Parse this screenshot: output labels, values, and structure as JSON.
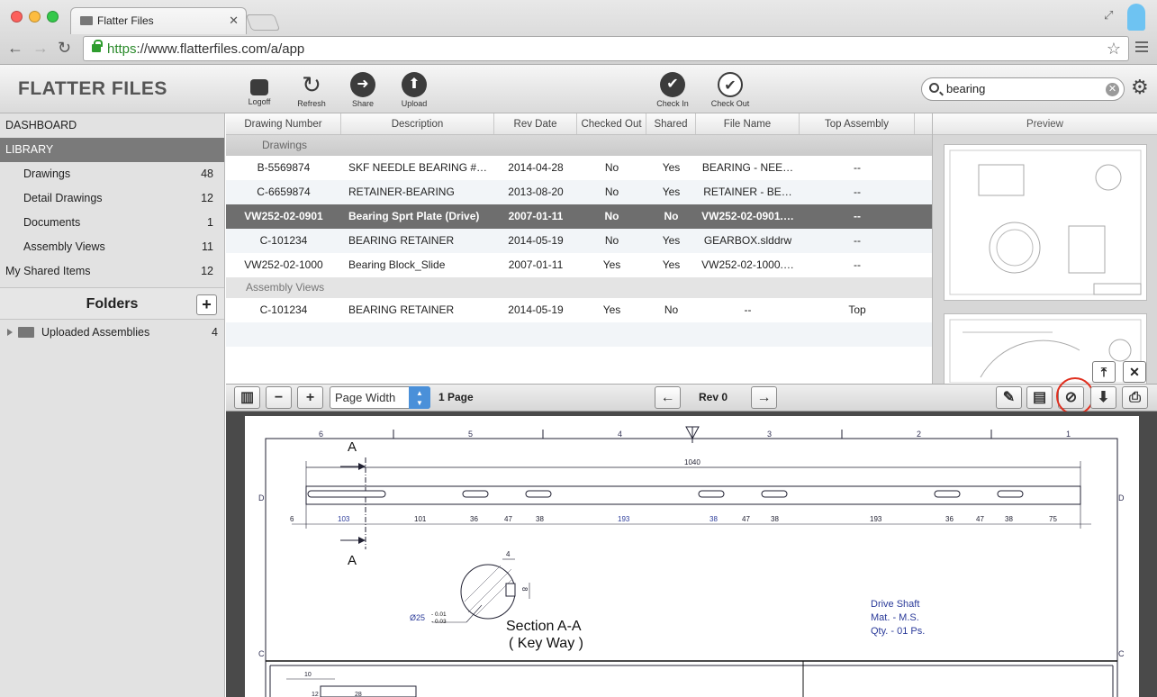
{
  "browser": {
    "tab_title": "Flatter Files",
    "url_scheme": "https",
    "url_rest": "://www.flatterfiles.com/a/app"
  },
  "app": {
    "logo": "FLATTER FILES",
    "toolbar": {
      "logoff": "Logoff",
      "refresh": "Refresh",
      "share": "Share",
      "upload": "Upload",
      "check_in": "Check In",
      "check_out": "Check Out"
    },
    "search_value": "bearing"
  },
  "sidebar": {
    "dashboard": "DASHBOARD",
    "library": "LIBRARY",
    "items": [
      {
        "label": "Drawings",
        "count": "48"
      },
      {
        "label": "Detail Drawings",
        "count": "12"
      },
      {
        "label": "Documents",
        "count": "1"
      },
      {
        "label": "Assembly Views",
        "count": "11"
      }
    ],
    "shared": {
      "label": "My Shared Items",
      "count": "12"
    },
    "folders_title": "Folders",
    "folder": {
      "label": "Uploaded Assemblies",
      "count": "4"
    }
  },
  "table": {
    "headers": [
      "Drawing Number",
      "Description",
      "Rev Date",
      "Checked Out",
      "Shared",
      "File Name",
      "Top Assembly"
    ],
    "group1": "Drawings",
    "rows": [
      [
        "B-5569874",
        "SKF NEEDLE BEARING #…",
        "2014-04-28",
        "No",
        "Yes",
        "BEARING - NEE…",
        "--"
      ],
      [
        "C-6659874",
        "RETAINER-BEARING",
        "2013-08-20",
        "No",
        "Yes",
        "RETAINER - BE…",
        "--"
      ],
      [
        "VW252-02-0901",
        "Bearing Sprt  Plate (Drive)",
        "2007-01-11",
        "No",
        "No",
        "VW252-02-0901.…",
        "--"
      ],
      [
        "C-101234",
        "BEARING RETAINER",
        "2014-05-19",
        "No",
        "Yes",
        "GEARBOX.slddrw",
        "--"
      ],
      [
        "VW252-02-1000",
        "Bearing Block_Slide",
        "2007-01-11",
        "Yes",
        "Yes",
        "VW252-02-1000.…",
        "--"
      ]
    ],
    "group2": "Assembly Views",
    "rows2": [
      [
        "C-101234",
        "BEARING RETAINER",
        "2014-05-19",
        "Yes",
        "No",
        "--",
        "Top"
      ]
    ]
  },
  "preview": {
    "title": "Preview"
  },
  "pdfbar": {
    "zoom": "Page Width",
    "pages": "1 Page",
    "rev": "Rev 0"
  },
  "drawing": {
    "zones_top": [
      "6",
      "5",
      "4",
      "3",
      "2",
      "1"
    ],
    "zone_d": "D",
    "zone_c": "C",
    "section_letter": "A",
    "overall_dim": "1040",
    "dims": [
      "6",
      "103",
      "101",
      "36",
      "47",
      "38",
      "193",
      "38",
      "47",
      "38",
      "193",
      "36",
      "47",
      "38",
      "75"
    ],
    "keyway_dim": "4",
    "keyway_depth": "8",
    "diameter": "Ø25",
    "tol_plus": "- 0.01",
    "tol_minus": "- 0.03",
    "section_title": "Section A-A",
    "section_sub": "( Key Way )",
    "note1": "Drive Shaft",
    "note2": "Mat. - M.S.",
    "note3": "Qty. - 01 Ps.",
    "small_dim1": "10",
    "small_dim2": "12",
    "small_dim3": "28"
  }
}
